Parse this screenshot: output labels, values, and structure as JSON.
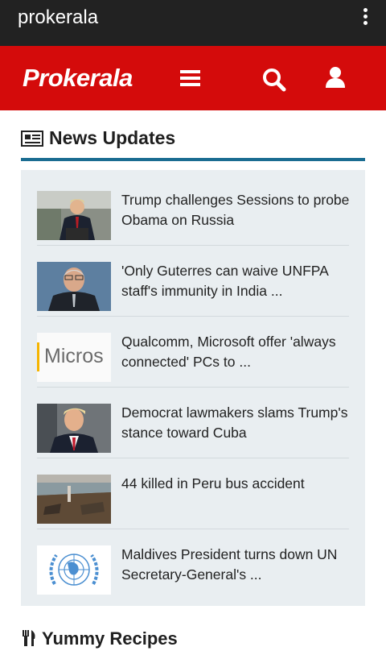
{
  "appbar": {
    "title": "prokerala",
    "menu_icon": "overflow-menu-icon"
  },
  "header": {
    "logo": "Prokerala",
    "menu_icon": "hamburger-menu-icon",
    "search_icon": "search-icon",
    "user_icon": "user-icon",
    "brand_color": "#d40b0b"
  },
  "news": {
    "title": "News Updates",
    "icon": "newspaper-icon",
    "accent_color": "#1a6c91",
    "items": [
      {
        "headline": "Trump challenges Sessions to probe Obama on Russia",
        "thumb": "trump-podium-photo"
      },
      {
        "headline": "'Only Guterres can waive UNFPA staff's immunity in India ...",
        "thumb": "guterres-photo"
      },
      {
        "headline": "Qualcomm, Microsoft offer 'always connected' PCs to ...",
        "thumb": "microsoft-logo-crop",
        "thumb_text": "Micros"
      },
      {
        "headline": "Democrat lawmakers slams Trump's stance toward Cuba",
        "thumb": "trump-portrait-photo"
      },
      {
        "headline": "44 killed in Peru bus accident",
        "thumb": "peru-bus-accident-photo"
      },
      {
        "headline": "Maldives President turns down UN Secretary-General's ...",
        "thumb": "un-emblem"
      }
    ]
  },
  "recipes": {
    "title": "Yummy Recipes",
    "icon": "fork-knife-icon"
  }
}
